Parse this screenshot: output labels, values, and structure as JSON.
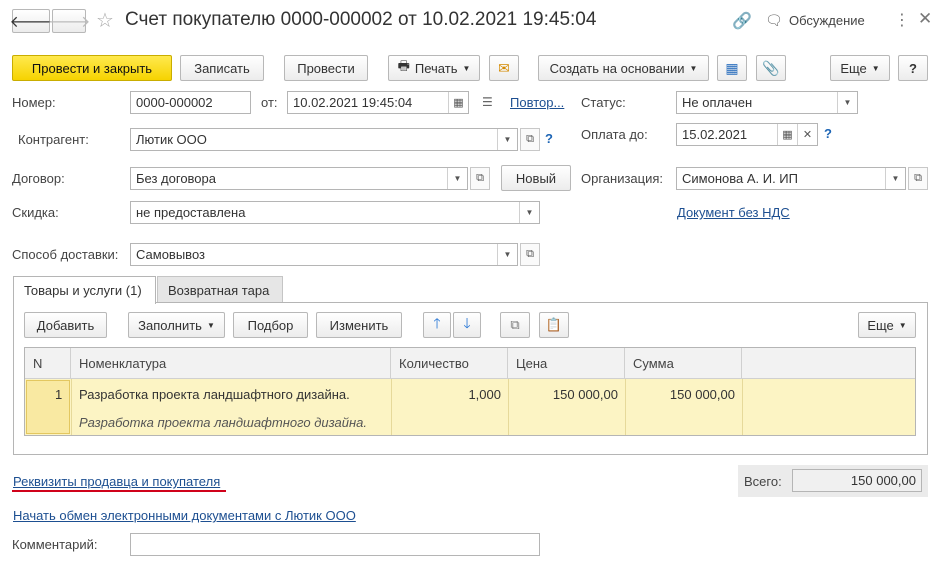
{
  "window": {
    "title": "Счет покупателю 0000-000002 от 10.02.2021 19:45:04",
    "discussion_label": "Обсуждение"
  },
  "toolbar": {
    "post_close": "Провести и закрыть",
    "save": "Записать",
    "post": "Провести",
    "print": "Печать",
    "create_based": "Создать на основании",
    "more": "Еще",
    "help": "?"
  },
  "form": {
    "number_label": "Номер:",
    "number_value": "0000-000002",
    "from_label": "от:",
    "date_value": "10.02.2021 19:45:04",
    "repeat_link": "Повтор...",
    "status_label": "Статус:",
    "status_value": "Не оплачен",
    "counterparty_label": "Контрагент:",
    "counterparty_value": "Лютик ООО",
    "pay_until_label": "Оплата до:",
    "pay_until_value": "15.02.2021",
    "contract_label": "Договор:",
    "contract_value": "Без договора",
    "new_button": "Новый",
    "org_label": "Организация:",
    "org_value": "Симонова А. И. ИП",
    "discount_label": "Скидка:",
    "discount_value": "не предоставлена",
    "no_vat_link": "Документ без НДС",
    "delivery_label": "Способ доставки:",
    "delivery_value": "Самовывоз"
  },
  "tabs": [
    {
      "label": "Товары и услуги (1)"
    },
    {
      "label": "Возвратная тара"
    }
  ],
  "table_toolbar": {
    "add": "Добавить",
    "fill": "Заполнить",
    "select": "Подбор",
    "change": "Изменить",
    "more": "Еще"
  },
  "table": {
    "columns": [
      "N",
      "Номенклатура",
      "Количество",
      "Цена",
      "Сумма"
    ],
    "rows": [
      {
        "n": "1",
        "name": "Разработка проекта ландшафтного дизайна.",
        "name_sub": "Разработка проекта ландшафтного дизайна.",
        "qty": "1,000",
        "price": "150 000,00",
        "sum": "150 000,00"
      }
    ]
  },
  "footer": {
    "requisites_link": "Реквизиты продавца и покупателя",
    "total_label": "Всего:",
    "total_value": "150 000,00",
    "edo_link": "Начать обмен электронными документами с Лютик ООО",
    "comment_label": "Комментарий:",
    "comment_value": ""
  },
  "colors": {
    "primary_button": "#f6d300",
    "selected_row": "#fcf4c4",
    "link": "#1d4f91",
    "underline_red": "#d0021b"
  }
}
